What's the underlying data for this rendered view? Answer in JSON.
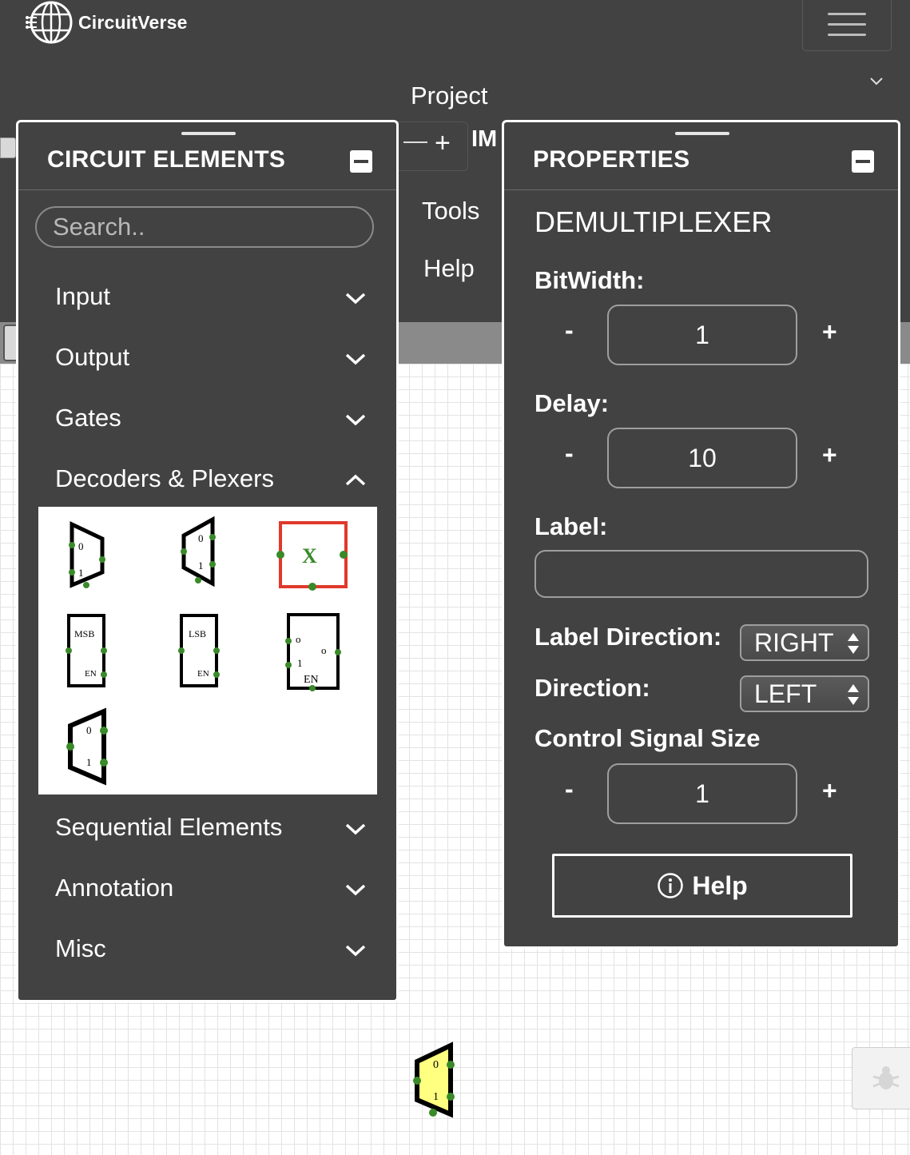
{
  "app": {
    "brand_name": "CircuitVerse",
    "menu": {
      "project": "Project",
      "tools": "Tools",
      "help": "Help"
    },
    "tab": {
      "plus": "+",
      "partial_label": "IM"
    }
  },
  "circuit_elements": {
    "title": "CIRCUIT ELEMENTS",
    "search_placeholder": "Search..",
    "categories": [
      {
        "label": "Input",
        "expanded": false
      },
      {
        "label": "Output",
        "expanded": false
      },
      {
        "label": "Gates",
        "expanded": false
      },
      {
        "label": "Decoders & Plexers",
        "expanded": true
      },
      {
        "label": "Sequential Elements",
        "expanded": false
      },
      {
        "label": "Annotation",
        "expanded": false
      },
      {
        "label": "Misc",
        "expanded": false
      }
    ],
    "plexer_elements": {
      "mux_bit0": "0",
      "mux_bit1": "1",
      "x_element": "X",
      "msb": "MSB",
      "lsb": "LSB",
      "en": "EN",
      "decoder_o": "o",
      "decoder_1": "1"
    }
  },
  "properties": {
    "title": "PROPERTIES",
    "element_name": "DEMULTIPLEXER",
    "bitwidth_label": "BitWidth:",
    "bitwidth_value": "1",
    "delay_label": "Delay:",
    "delay_value": "10",
    "label_label": "Label:",
    "label_value": "",
    "label_direction_label": "Label Direction:",
    "label_direction_value": "RIGHT",
    "direction_label": "Direction:",
    "direction_value": "LEFT",
    "control_signal_label": "Control Signal Size",
    "control_signal_value": "1",
    "minus": "-",
    "plus": "+",
    "help_button": "Help"
  },
  "canvas": {
    "demux_bit0": "0",
    "demux_bit1": "1",
    "colors": {
      "selected_fill": "#ffff80",
      "pin": "#3a8a2a",
      "highlight": "#e0392b"
    }
  }
}
